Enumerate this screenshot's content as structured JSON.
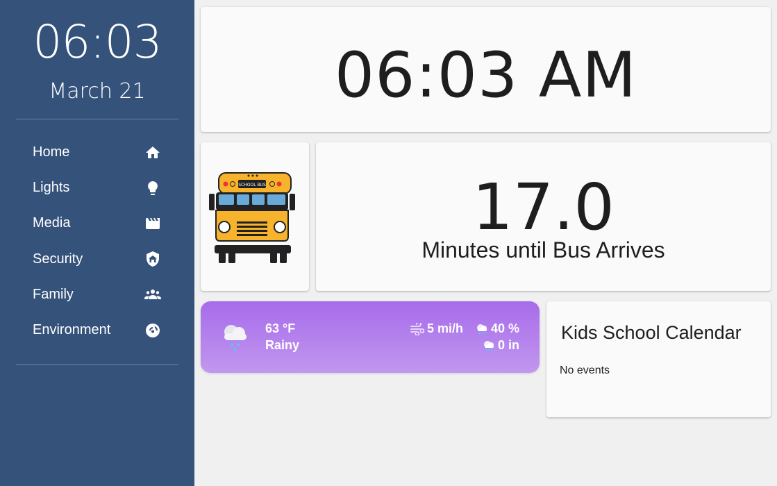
{
  "sidebar": {
    "time": "06:03",
    "date": "March 21",
    "items": [
      {
        "label": "Home",
        "icon": "home-icon"
      },
      {
        "label": "Lights",
        "icon": "lightbulb-icon"
      },
      {
        "label": "Media",
        "icon": "clapperboard-icon"
      },
      {
        "label": "Security",
        "icon": "shield-home-icon"
      },
      {
        "label": "Family",
        "icon": "people-icon"
      },
      {
        "label": "Environment",
        "icon": "gauge-icon"
      }
    ],
    "colors": {
      "background": "#34527a",
      "text": "#ffffff"
    }
  },
  "clock": {
    "time": "06:03 AM"
  },
  "bus": {
    "image": "school-bus-icon",
    "sign": "SCHOOL BUS"
  },
  "minutes": {
    "value": "17.0",
    "label": "Minutes until Bus Arrives"
  },
  "weather": {
    "icon": "rainy-cloud-icon",
    "temperature": "63 °F",
    "condition": "Rainy",
    "wind": "5 mi/h",
    "precip_probability": "40 %",
    "precipitation": "0 in",
    "colors": {
      "gradient_top": "#a76bea",
      "gradient_bottom": "#c197ef"
    }
  },
  "calendar": {
    "title": "Kids School Calendar",
    "empty_text": "No events"
  },
  "colors": {
    "page_background": "#f0f0f0",
    "card_background": "#fafafa",
    "text": "#1e1e1e"
  }
}
